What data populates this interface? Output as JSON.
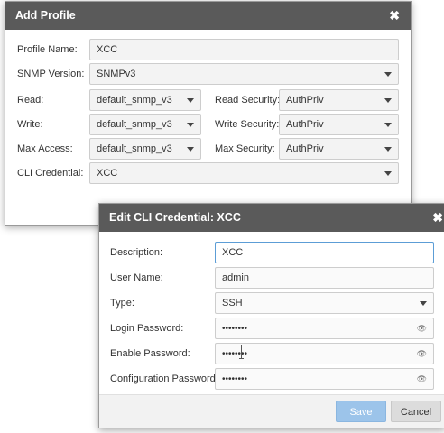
{
  "add_profile": {
    "title": "Add Profile",
    "close_glyph": "✖",
    "profile_name_label": "Profile Name:",
    "profile_name_value": "XCC",
    "snmp_version_label": "SNMP Version:",
    "snmp_version_value": "SNMPv3",
    "read_label": "Read:",
    "read_value": "default_snmp_v3",
    "read_security_label": "Read Security:",
    "read_security_value": "AuthPriv",
    "write_label": "Write:",
    "write_value": "default_snmp_v3",
    "write_security_label": "Write Security:",
    "write_security_value": "AuthPriv",
    "max_access_label": "Max Access:",
    "max_access_value": "default_snmp_v3",
    "max_security_label": "Max Security:",
    "max_security_value": "AuthPriv",
    "cli_credential_label": "CLI Credential:",
    "cli_credential_value": "XCC"
  },
  "edit_cli": {
    "title": "Edit CLI Credential: XCC",
    "close_glyph": "✖",
    "description_label": "Description:",
    "description_value": "XCC",
    "username_label": "User Name:",
    "username_value": "admin",
    "type_label": "Type:",
    "type_value": "SSH",
    "login_password_label": "Login Password:",
    "login_password_value": "••••••••",
    "enable_password_label": "Enable Password:",
    "enable_password_value": "••••••••",
    "config_password_label": "Configuration Password:",
    "config_password_value": "••••••••",
    "eye_glyph": "👁",
    "save_label": "Save",
    "cancel_label": "Cancel"
  },
  "colors": {
    "titlebar": "#5a5a5a",
    "focus_border": "#5c9dd6",
    "save_button": "#9cc4ea",
    "cancel_button": "#dcdcdc"
  }
}
